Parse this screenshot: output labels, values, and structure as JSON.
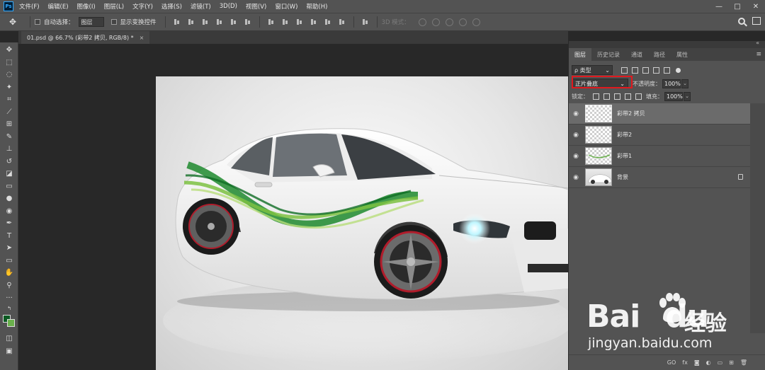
{
  "app": {
    "logo": "Ps"
  },
  "menu": [
    "文件(F)",
    "编辑(E)",
    "图像(I)",
    "图层(L)",
    "文字(Y)",
    "选择(S)",
    "滤镜(T)",
    "3D(D)",
    "视图(V)",
    "窗口(W)",
    "帮助(H)"
  ],
  "window_controls": {
    "minimize": "—",
    "maximize": "□",
    "close": "✕"
  },
  "options": {
    "auto_select_label": "自动选择：",
    "auto_select_value": "图层",
    "show_transform_label": "显示变换控件",
    "mode3d_label": "3D 模式："
  },
  "document": {
    "tab_title": "01.psd @ 66.7% (彩带2 拷贝, RGB/8) *",
    "tab_close": "×"
  },
  "panel": {
    "tabs": [
      {
        "label": "图层",
        "active": true
      },
      {
        "label": "历史记录"
      },
      {
        "label": "通道"
      },
      {
        "label": "路径"
      },
      {
        "label": "属性"
      }
    ],
    "filter_value": "ρ 类型",
    "blend_mode": "正片叠底",
    "opacity_label": "不透明度：",
    "opacity_value": "100%",
    "lock_label": "锁定：",
    "fill_label": "填充：",
    "fill_value": "100%",
    "layers": [
      {
        "name": "彩带2 拷贝",
        "selected": true
      },
      {
        "name": "彩带2"
      },
      {
        "name": "彩带1"
      },
      {
        "name": "背景",
        "locked": true
      }
    ],
    "bottom_icons": [
      "GO",
      "fx"
    ]
  },
  "watermark": {
    "brand": "Bai",
    "brand2": "du",
    "cn": "经验",
    "url": "jingyan.baidu.com"
  },
  "colors": {
    "foreground": "#0c5a23",
    "background": "#6ab04c",
    "highlight": "#e0191e"
  }
}
